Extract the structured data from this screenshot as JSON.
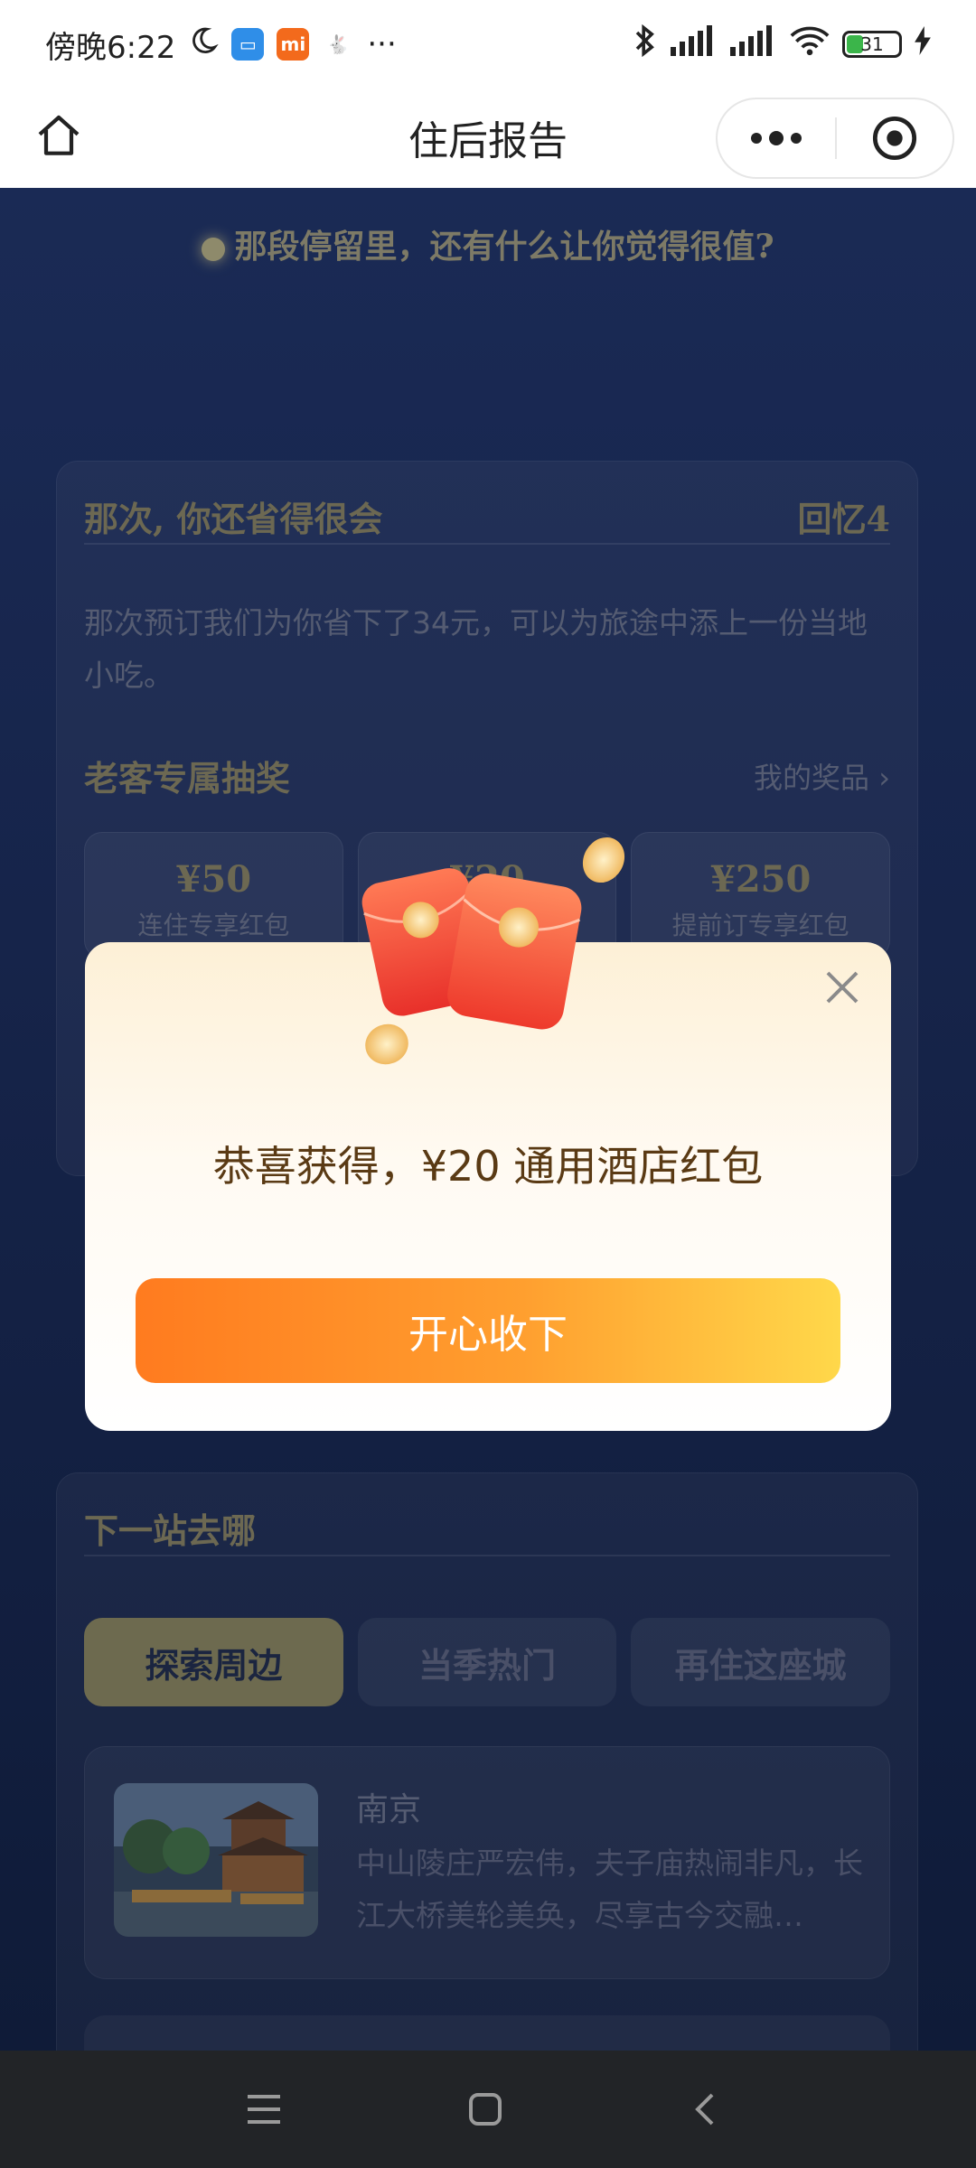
{
  "status_bar": {
    "time": "傍晚6:22",
    "battery": "31"
  },
  "nav": {
    "title": "住后报告"
  },
  "question": "那段停留里，还有什么让你觉得很值?",
  "memory_card": {
    "title": "那次, 你还省得很会",
    "tag": "回忆4",
    "text": "那次预订我们为你省下了34元，可以为旅途中添上一份当地小吃。",
    "lottery_title": "老客专属抽奖",
    "my_prize": "我的奖品 ›",
    "prizes": [
      {
        "amount": "¥50",
        "name": "连住专享红包"
      },
      {
        "amount": "¥20",
        "name": ""
      },
      {
        "amount": "¥250",
        "name": "提前订专享红包"
      }
    ]
  },
  "next_card": {
    "title": "下一站去哪",
    "tabs": [
      "探索周边",
      "当季热门",
      "再住这座城"
    ],
    "destination": {
      "name": "南京",
      "desc": "中山陵庄严宏伟，夫子庙热闹非凡，长江大桥美轮美奂，尽享古今交融…"
    }
  },
  "modal": {
    "title": "恭喜获得，¥20 通用酒店红包",
    "button": "开心收下"
  },
  "colors": {
    "accent_orange": "#ff7b1f",
    "accent_yellow": "#ffd84a",
    "page_bg": "#0f1a33"
  }
}
